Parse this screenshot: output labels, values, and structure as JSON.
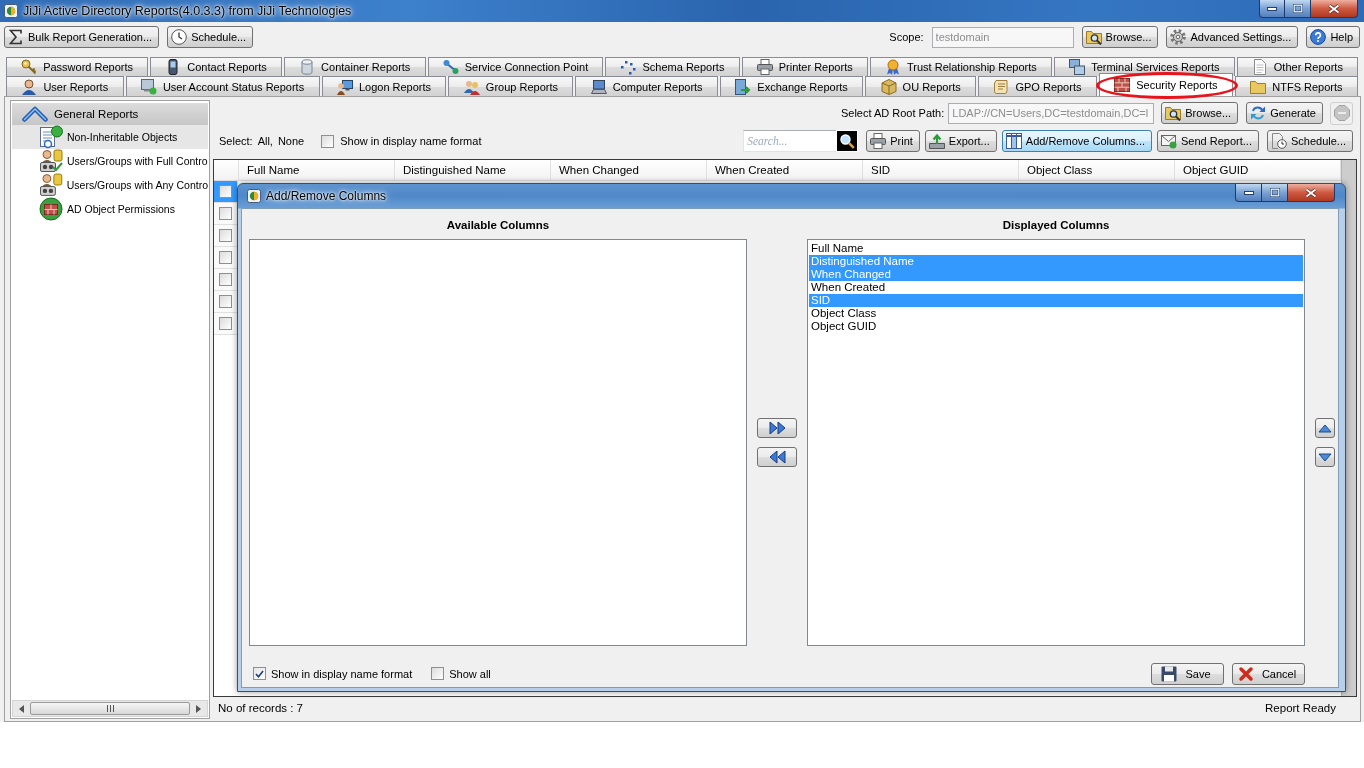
{
  "window": {
    "title": "JiJi Active Directory Reports(4.0.3.3) from JiJi Technologies"
  },
  "toolbar": {
    "left_buttons": [
      "Bulk Report Generation...",
      "Schedule..."
    ],
    "scope": {
      "label": "Scope:",
      "value": "testdomain",
      "disabled": true
    },
    "right_buttons": [
      "Browse...",
      "Advanced Settings...",
      "Help"
    ]
  },
  "tab_rows": [
    {
      "tabs": [
        {
          "label": "Password Reports",
          "selected": false
        },
        {
          "label": "Contact Reports",
          "selected": false
        },
        {
          "label": "Container Reports",
          "selected": false
        },
        {
          "label": "Service Connection Point",
          "selected": false
        },
        {
          "label": "Schema Reports",
          "selected": false
        },
        {
          "label": "Printer Reports",
          "selected": false
        },
        {
          "label": "Trust Relationship Reports",
          "selected": false
        },
        {
          "label": "Terminal Services Reports",
          "selected": false
        },
        {
          "label": "Other Reports",
          "selected": false
        }
      ]
    },
    {
      "tabs": [
        {
          "label": "User Reports",
          "selected": false
        },
        {
          "label": "User Account Status Reports",
          "selected": false
        },
        {
          "label": "Logon Reports",
          "selected": false
        },
        {
          "label": "Group Reports",
          "selected": false
        },
        {
          "label": "Computer Reports",
          "selected": false
        },
        {
          "label": "Exchange Reports",
          "selected": false
        },
        {
          "label": "OU Reports",
          "selected": false
        },
        {
          "label": "GPO Reports",
          "selected": false
        },
        {
          "label": "Security Reports",
          "selected": true
        },
        {
          "label": "NTFS Reports",
          "selected": false
        }
      ]
    }
  ],
  "sidebar": {
    "group": {
      "label": "General Reports",
      "expanded": true
    },
    "items": [
      {
        "label": "Non-Inheritable Objects",
        "selected": true
      },
      {
        "label": "Users/Groups with Full Contro",
        "selected": false
      },
      {
        "label": "Users/Groups with Any Contro",
        "selected": false
      },
      {
        "label": "AD Object Permissions",
        "selected": false
      }
    ]
  },
  "report": {
    "root_path": {
      "label": "Select AD Root Path:",
      "value": "LDAP://CN=Users,DC=testdomain,DC=l",
      "disabled": true
    },
    "browse_button": "Browse...",
    "generate_button": "Generate",
    "stop_button": {
      "disabled": true
    },
    "select": {
      "label": "Select:",
      "links": [
        "All,",
        "None"
      ]
    },
    "display_name_option": {
      "label": "Show in display name format",
      "checked": false
    },
    "search": {
      "placeholder": "Search..."
    },
    "actions": [
      {
        "label": "Print",
        "focused": false
      },
      {
        "label": "Export...",
        "focused": false
      },
      {
        "label": "Add/Remove Columns...",
        "focused": true
      },
      {
        "label": "Send Report...",
        "focused": false
      },
      {
        "label": "Schedule...",
        "focused": false
      }
    ]
  },
  "grid": {
    "columns": [
      "Full Name",
      "Distinguished Name",
      "When Changed",
      "When Created",
      "SID",
      "Object Class",
      "Object GUID"
    ],
    "rows": [
      {
        "checked": false,
        "selected": true
      },
      {
        "checked": false,
        "selected": false
      },
      {
        "checked": false,
        "selected": false
      },
      {
        "checked": false,
        "selected": false
      },
      {
        "checked": false,
        "selected": false
      },
      {
        "checked": false,
        "selected": false
      },
      {
        "checked": false,
        "selected": false
      }
    ]
  },
  "dialog": {
    "title": "Add/Remove Columns",
    "available_heading": "Available Columns",
    "displayed_heading": "Displayed Columns",
    "displayed_items": [
      {
        "label": "Full Name",
        "selected": false
      },
      {
        "label": "Distinguished Name",
        "selected": true
      },
      {
        "label": "When Changed",
        "selected": true
      },
      {
        "label": "When Created",
        "selected": false
      },
      {
        "label": "SID",
        "selected": true
      },
      {
        "label": "Object Class",
        "selected": false
      },
      {
        "label": "Object GUID",
        "selected": false
      }
    ],
    "options": [
      {
        "label": "Show in display name format",
        "checked": true
      },
      {
        "label": "Show all",
        "checked": false
      }
    ],
    "buttons": [
      "Save",
      "Cancel"
    ]
  },
  "status_bar": {
    "left": "No of records : 7",
    "right": "Report Ready"
  }
}
